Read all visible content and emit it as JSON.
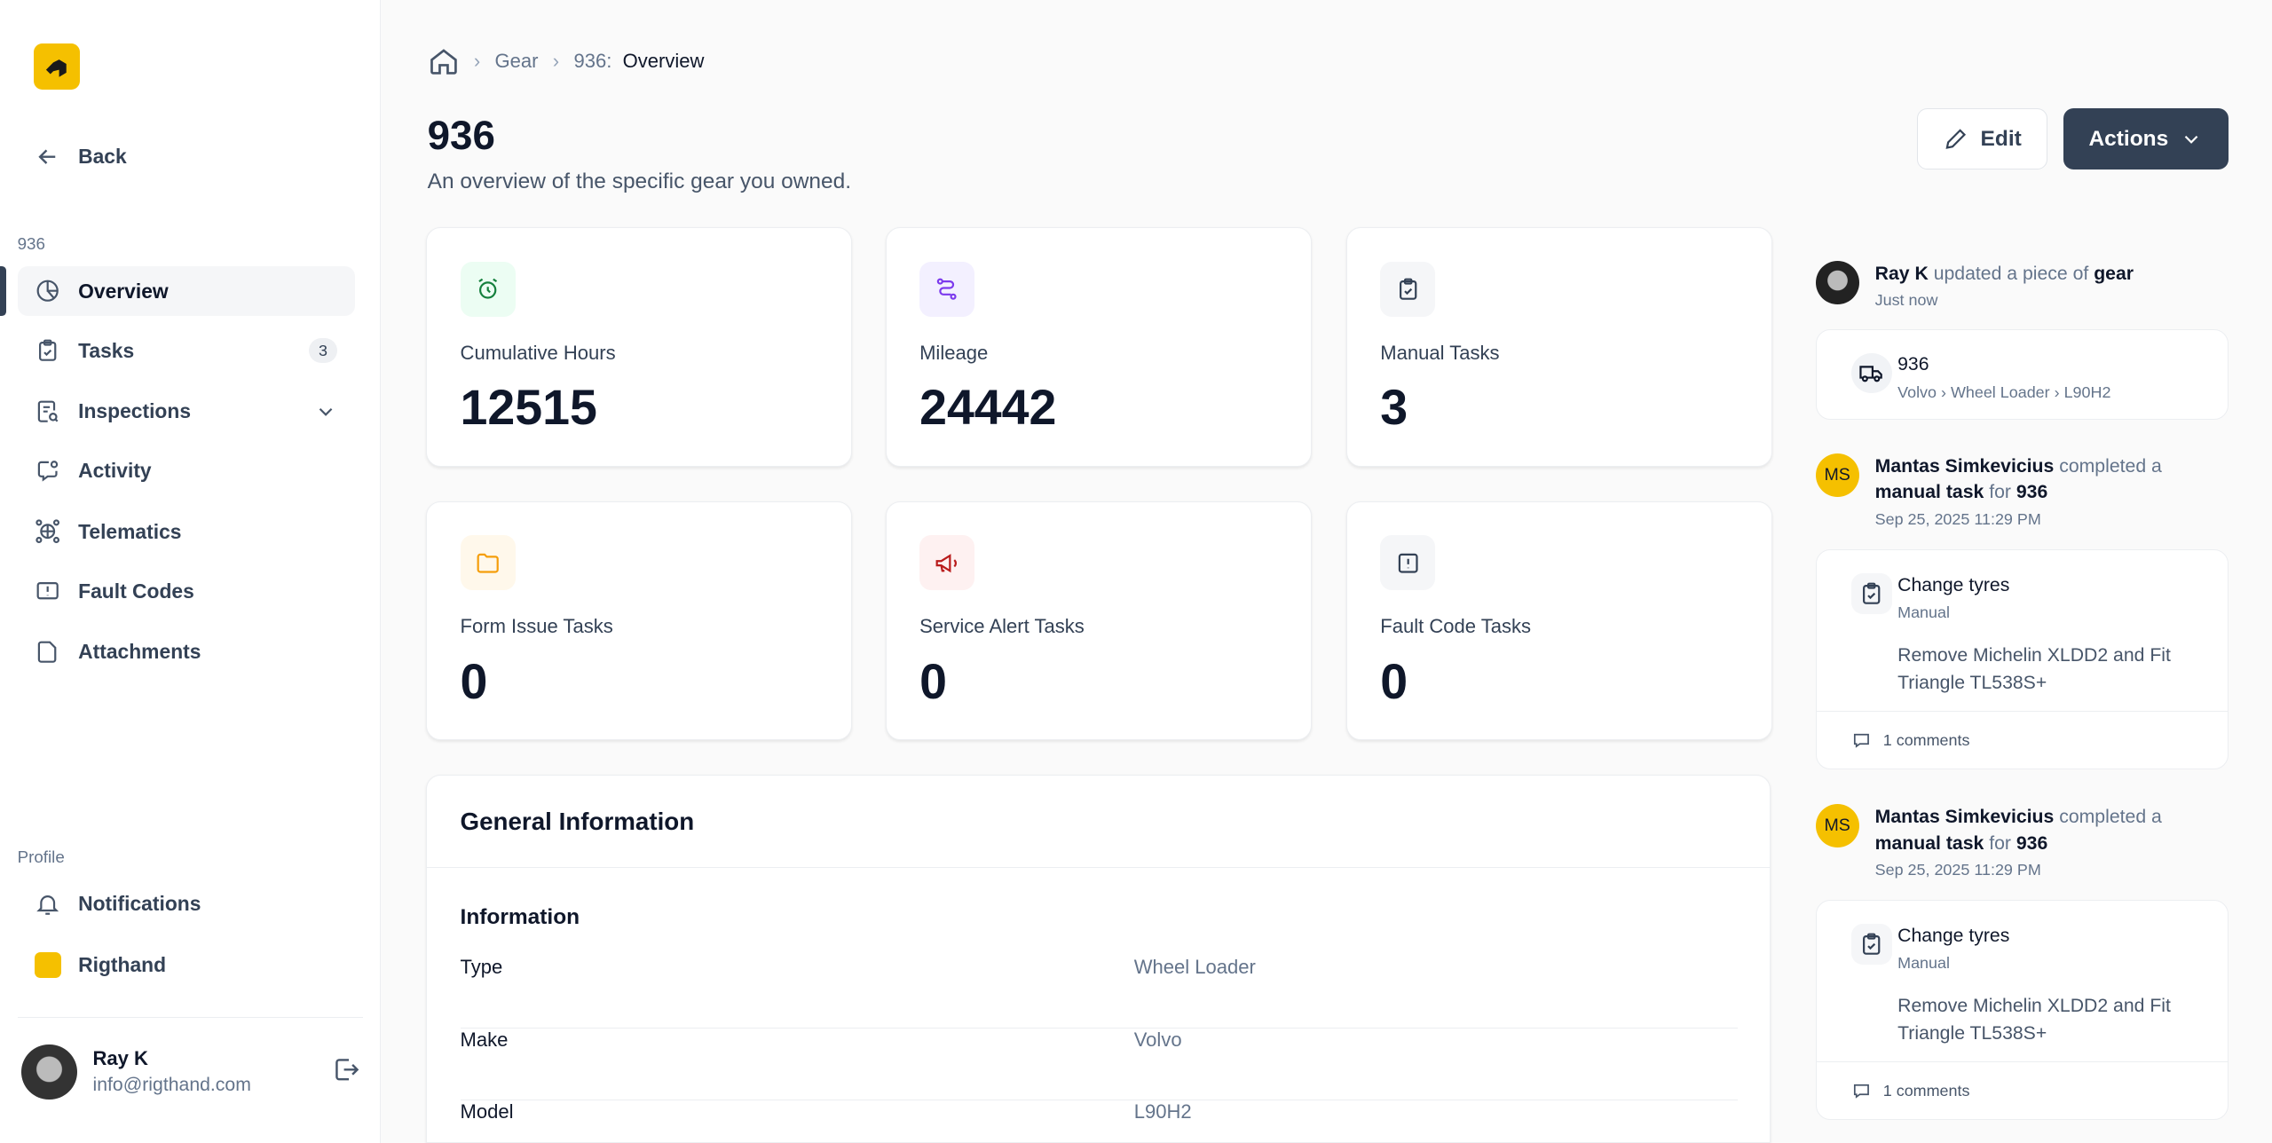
{
  "sidebar": {
    "back": "Back",
    "section": "936",
    "items": [
      {
        "label": "Overview"
      },
      {
        "label": "Tasks",
        "badge": "3"
      },
      {
        "label": "Inspections"
      },
      {
        "label": "Activity"
      },
      {
        "label": "Telematics"
      },
      {
        "label": "Fault Codes"
      },
      {
        "label": "Attachments"
      }
    ],
    "profile_label": "Profile",
    "notifications": "Notifications",
    "org": "Rigthand",
    "user": {
      "name": "Ray K",
      "email": "info@rigthand.com"
    }
  },
  "breadcrumb": {
    "gear": "Gear",
    "item": "936:",
    "current": "Overview"
  },
  "header": {
    "title": "936",
    "subtitle": "An overview of the specific gear you owned.",
    "edit": "Edit",
    "actions": "Actions"
  },
  "stats": [
    {
      "label": "Cumulative Hours",
      "value": "12515",
      "color": "#15803d",
      "bg": "#ecfdf3"
    },
    {
      "label": "Mileage",
      "value": "24442",
      "color": "#7c3aed",
      "bg": "#f3f0ff"
    },
    {
      "label": "Manual Tasks",
      "value": "3",
      "color": "#334155",
      "bg": "#f5f6f8"
    },
    {
      "label": "Form Issue Tasks",
      "value": "0",
      "color": "#f59e0b",
      "bg": "#fff8eb"
    },
    {
      "label": "Service Alert Tasks",
      "value": "0",
      "color": "#b91c1c",
      "bg": "#fef1f1"
    },
    {
      "label": "Fault Code Tasks",
      "value": "0",
      "color": "#334155",
      "bg": "#f5f6f8"
    }
  ],
  "general": {
    "title": "General Information",
    "section": "Information",
    "rows": [
      {
        "k": "Type",
        "v": "Wheel Loader"
      },
      {
        "k": "Make",
        "v": "Volvo"
      },
      {
        "k": "Model",
        "v": "L90H2"
      }
    ]
  },
  "feed": [
    {
      "actor": "Ray K",
      "verb": "updated a piece of",
      "object": "gear",
      "time": "Just now",
      "card": {
        "title": "936",
        "sub": "Volvo › Wheel Loader › L90H2"
      }
    },
    {
      "initials": "MS",
      "actor": "Mantas Simkevicius",
      "verb": "completed a",
      "object": "manual task",
      "prep": "for",
      "target": "936",
      "time": "Sep 25, 2025 11:29 PM",
      "card": {
        "title": "Change tyres",
        "sub": "Manual",
        "desc": "Remove Michelin XLDD2 and Fit Triangle TL538S+",
        "comments": "1 comments"
      }
    },
    {
      "initials": "MS",
      "actor": "Mantas Simkevicius",
      "verb": "completed a",
      "object": "manual task",
      "prep": "for",
      "target": "936",
      "time": "Sep 25, 2025 11:29 PM",
      "card": {
        "title": "Change tyres",
        "sub": "Manual",
        "desc": "Remove Michelin XLDD2 and Fit Triangle TL538S+",
        "comments": "1 comments"
      }
    }
  ]
}
